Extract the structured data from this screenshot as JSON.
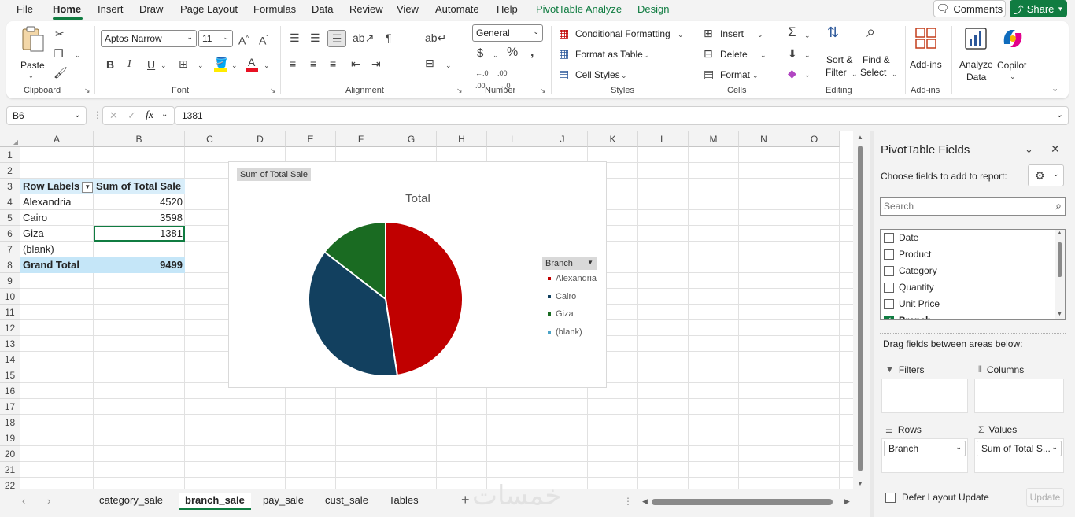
{
  "menu": {
    "tabs": [
      "File",
      "Home",
      "Insert",
      "Draw",
      "Page Layout",
      "Formulas",
      "Data",
      "Review",
      "View",
      "Automate",
      "Help",
      "PivotTable Analyze",
      "Design"
    ],
    "comments": "Comments",
    "share": "Share"
  },
  "ribbon": {
    "clipboard": {
      "paste": "Paste",
      "label": "Clipboard"
    },
    "font": {
      "name": "Aptos Narrow",
      "size": "11",
      "label": "Font"
    },
    "alignment": {
      "label": "Alignment"
    },
    "number": {
      "format": "General",
      "label": "Number"
    },
    "styles": {
      "conditional": "Conditional Formatting",
      "format_table": "Format as Table",
      "cell_styles": "Cell Styles",
      "label": "Styles"
    },
    "cells": {
      "insert": "Insert",
      "delete": "Delete",
      "format": "Format",
      "label": "Cells"
    },
    "editing": {
      "sort1": "Sort &",
      "sort2": "Filter",
      "find1": "Find &",
      "find2": "Select",
      "label": "Editing"
    },
    "addins": {
      "addins": "Add-ins",
      "label": "Add-ins"
    },
    "analyze": {
      "l1": "Analyze",
      "l2": "Data"
    },
    "copilot": "Copilot"
  },
  "formula_bar": {
    "name_box": "B6",
    "formula": "1381",
    "fx": "fx"
  },
  "columns": [
    "A",
    "B",
    "C",
    "D",
    "E",
    "F",
    "G",
    "H",
    "I",
    "J",
    "K",
    "L",
    "M",
    "N",
    "O"
  ],
  "rows": [
    "1",
    "2",
    "3",
    "4",
    "5",
    "6",
    "7",
    "8",
    "9",
    "10",
    "11",
    "12",
    "13",
    "14",
    "15",
    "16",
    "17",
    "18",
    "19",
    "20",
    "21",
    "22"
  ],
  "pivot": {
    "header_labels": "Row Labels",
    "header_sum": "Sum of Total Sale",
    "rows": [
      {
        "label": "Alexandria",
        "value": "4520"
      },
      {
        "label": "Cairo",
        "value": "3598"
      },
      {
        "label": "Giza",
        "value": "1381"
      },
      {
        "label": "(blank)",
        "value": ""
      }
    ],
    "grand_label": "Grand Total",
    "grand_value": "9499"
  },
  "chart_data": {
    "type": "pie",
    "title": "Total",
    "field_button": "Sum of Total Sale",
    "legend_title": "Branch",
    "legend_position": "right",
    "categories": [
      "Alexandria",
      "Cairo",
      "Giza",
      "(blank)"
    ],
    "values": [
      4520,
      3598,
      1381,
      0
    ],
    "colors": [
      "#c00000",
      "#12405f",
      "#1a6b22",
      "#4ba3c7"
    ]
  },
  "sheet_tabs": [
    "category_sale",
    "branch_sale",
    "pay_sale",
    "cust_sale",
    "Tables"
  ],
  "active_sheet": "branch_sale",
  "watermark": "خمسات",
  "panel": {
    "title": "PivotTable Fields",
    "choose": "Choose fields to add to report:",
    "search_placeholder": "Search",
    "fields": [
      {
        "name": "Date",
        "checked": false
      },
      {
        "name": "Product",
        "checked": false
      },
      {
        "name": "Category",
        "checked": false
      },
      {
        "name": "Quantity",
        "checked": false
      },
      {
        "name": "Unit Price",
        "checked": false
      },
      {
        "name": "Branch",
        "checked": true
      }
    ],
    "drag": "Drag fields between areas below:",
    "filters": "Filters",
    "columns": "Columns",
    "rows": "Rows",
    "values": "Values",
    "rows_item": "Branch",
    "values_item": "Sum of Total S...",
    "defer": "Defer Layout Update",
    "update": "Update"
  }
}
